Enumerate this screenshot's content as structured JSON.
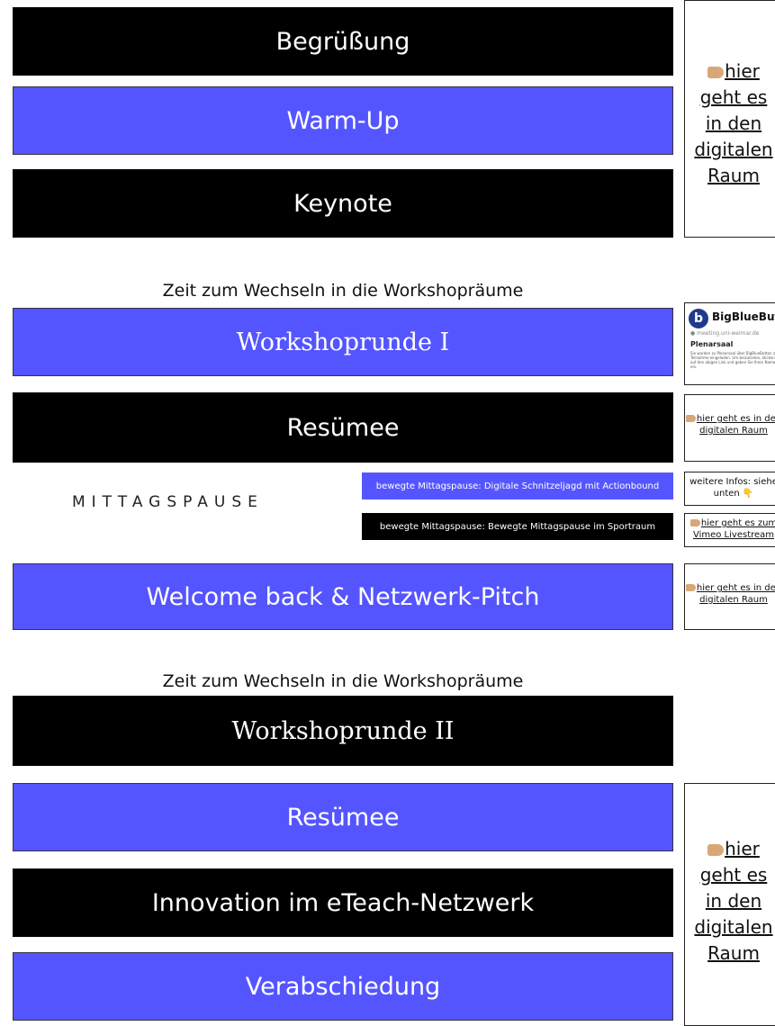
{
  "agenda": {
    "greeting": "Begrüßung",
    "warmup": "Warm-Up",
    "keynote": "Keynote",
    "switch_note_1": "Zeit zum Wechseln in die Workshopräume",
    "workshop_1": "Workshoprunde I",
    "resumee_1": "Resümee",
    "lunch": "MITTAGSPAUSE",
    "lunch_option_1": "bewegte Mittagspause: Digitale Schnitzeljagd mit Actionbound",
    "lunch_option_2": "bewegte Mittagspause: Bewegte Mittagspause im Sportraum",
    "welcome_back": "Welcome back & Netzwerk-Pitch",
    "switch_note_2": "Zeit zum Wechseln in die Workshopräume",
    "workshop_2": "Workshoprunde II",
    "resumee_2": "Resümee",
    "innovation": "Innovation im eTeach-Netzwerk",
    "farewell": "Verabschiedung"
  },
  "side_links": {
    "top_lines": [
      "hier",
      "geht es",
      "in den",
      "digitalen",
      "Raum"
    ],
    "bbb_title": "BigBlueButton",
    "bbb_domain": "meeting.uni-weimar.de",
    "bbb_room": "Plenarsaal",
    "bbb_text": "Sie wurden zu Plenarsaal über BigBlueButton zur Teilnahme eingeladen. Um beizutreten, klicken Sie auf den obigen Link und geben Sie Ihren Namen ein.",
    "resumee_link": "hier geht es in den digitalen Raum",
    "infos_text": "weitere Infos: siehe unten 👇",
    "vimeo_link": "hier geht es zum Vimeo Livestream",
    "welcome_link": "hier geht es in den digitalen Raum",
    "bottom_lines": [
      "hier",
      "geht es",
      "in den",
      "digitalen",
      "Raum"
    ]
  },
  "colors": {
    "blue": "#5555ff",
    "black": "#000000",
    "hand": "#d9a777"
  }
}
